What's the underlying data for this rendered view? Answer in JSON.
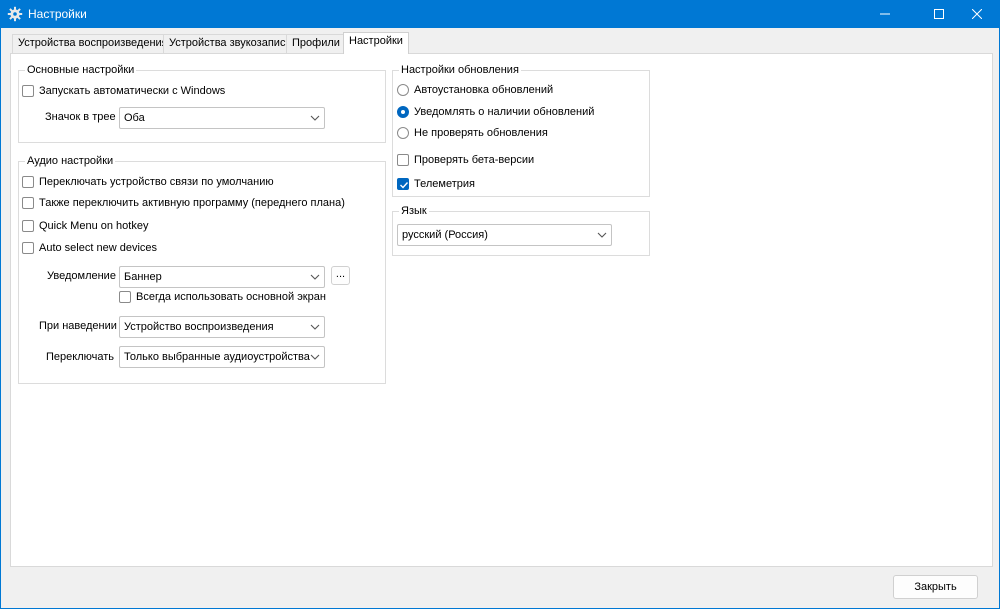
{
  "window": {
    "title": "Настройки",
    "icon": "gear-icon",
    "controls": [
      "minimize-icon",
      "maximize-icon",
      "close-icon"
    ],
    "accent": "#0078d4"
  },
  "tabs": [
    {
      "label": "Устройства воспроизведения",
      "active": false
    },
    {
      "label": "Устройства звукозаписи",
      "active": false
    },
    {
      "label": "Профили",
      "active": false
    },
    {
      "label": "Настройки",
      "active": true
    }
  ],
  "basic": {
    "title": "Основные настройки",
    "autostart": {
      "label": "Запускать автоматически с Windows",
      "checked": false
    },
    "tray_label": "Значок в трее",
    "tray_value": "Оба"
  },
  "audio": {
    "title": "Аудио настройки",
    "checks": [
      {
        "label": "Переключать устройство связи по умолчанию",
        "checked": false
      },
      {
        "label": "Также переключить активную программу (переднего плана)",
        "checked": false
      },
      {
        "label": "Quick Menu on hotkey",
        "checked": false
      },
      {
        "label": "Auto select new devices",
        "checked": false
      }
    ],
    "notify_label": "Уведомление",
    "notify_value": "Баннер",
    "notify_more": "...",
    "primary_screen": {
      "label": "Всегда использовать основной экран",
      "checked": false
    },
    "hover_label": "При наведении",
    "hover_value": "Устройство воспроизведения",
    "switch_label": "Переключать",
    "switch_value": "Только выбранные аудиоустройства"
  },
  "updates": {
    "title": "Настройки обновления",
    "radios": [
      {
        "label": "Автоустановка обновлений",
        "selected": false
      },
      {
        "label": "Уведомлять о наличии обновлений",
        "selected": true
      },
      {
        "label": "Не проверять обновления",
        "selected": false
      }
    ],
    "beta": {
      "label": "Проверять бета-версии",
      "checked": false
    },
    "telemetry": {
      "label": "Телеметрия",
      "checked": true
    }
  },
  "language": {
    "title": "Язык",
    "value": "русский (Россия)"
  },
  "footer": {
    "close_label": "Закрыть"
  }
}
